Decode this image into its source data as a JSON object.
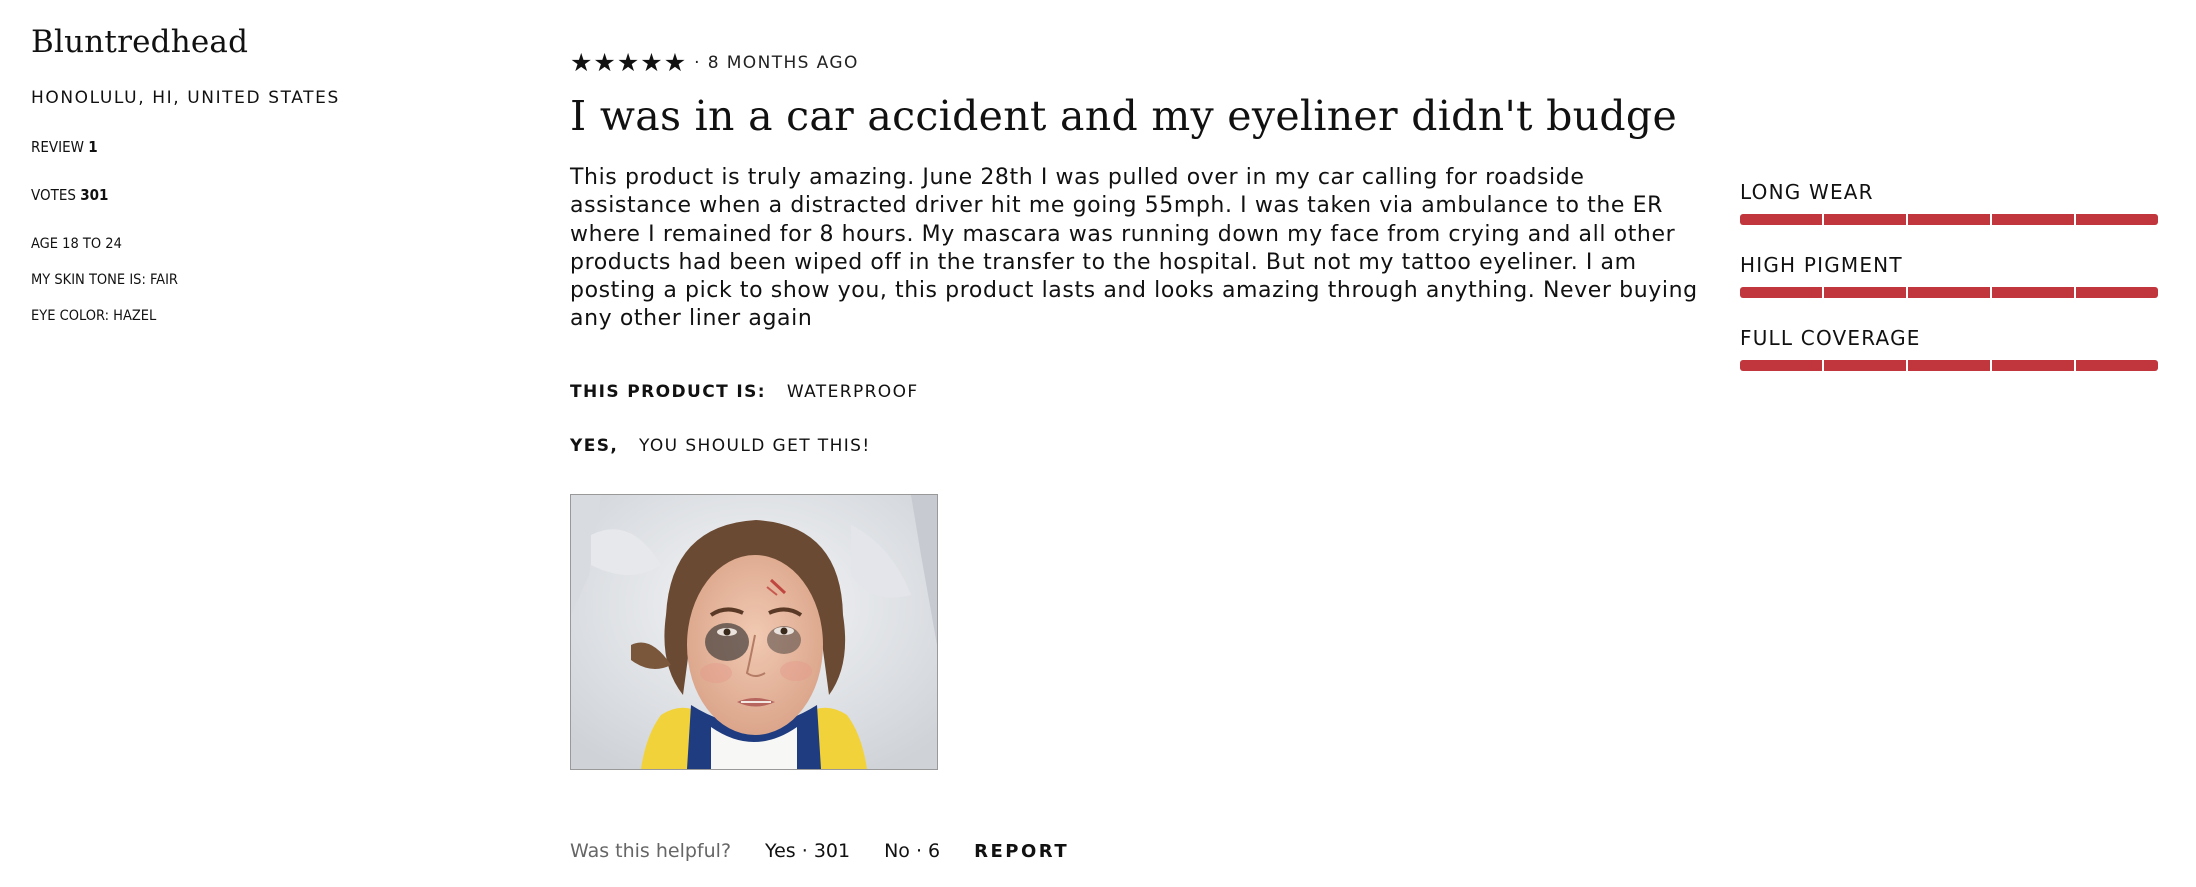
{
  "reviewer": {
    "name": "Bluntredhead",
    "location": "HONOLULU, HI, UNITED STATES",
    "review_label": "REVIEW",
    "review_count": "1",
    "votes_label": "VOTES",
    "votes_count": "301",
    "age": "AGE 18 TO 24",
    "skin_tone": "MY SKIN TONE IS: FAIR",
    "eye_color": "EYE COLOR: HAZEL"
  },
  "review": {
    "rating": 5,
    "stars": [
      "★",
      "★",
      "★",
      "★",
      "★"
    ],
    "time_ago": "· 8 MONTHS AGO",
    "title": "I was in a car accident and my eyeliner didn't budge",
    "body": "This product is truly amazing. June 28th I was pulled over in my car calling for roadside assistance when a distracted driver hit me going 55mph. I was taken via ambulance to the ER where I remained for 8 hours. My mascara was running down my face from crying and all other products had been wiped off in the transfer to the hospital. But not my tattoo eyeliner. I am posting a pick to show you, this product lasts and looks amazing through anything. Never buying any other liner again",
    "product_is_label": "THIS PRODUCT IS:",
    "product_is_value": "WATERPROOF",
    "recommend_label": "YES,",
    "recommend_value": "YOU SHOULD GET THIS!"
  },
  "helpful": {
    "question": "Was this helpful?",
    "yes": "Yes · 301",
    "no": "No · 6",
    "report": "REPORT"
  },
  "attributes": [
    {
      "label": "LONG WEAR",
      "level": 5,
      "max": 5
    },
    {
      "label": "HIGH PIGMENT",
      "level": 5,
      "max": 5
    },
    {
      "label": "FULL COVERAGE",
      "level": 5,
      "max": 5
    }
  ],
  "colors": {
    "bar_fill": "#c1353d"
  }
}
